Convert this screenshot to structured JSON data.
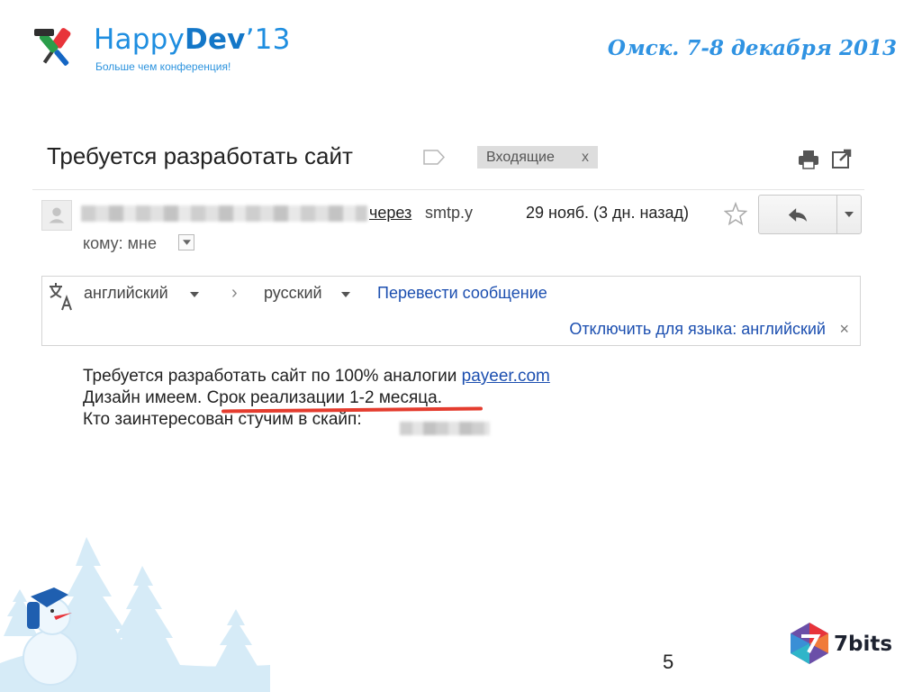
{
  "header": {
    "logo_happy": "Happy",
    "logo_dev": "Dev",
    "logo_year": "’13",
    "tagline": "Больше чем конференция!",
    "event_date": "Омск. 7-8 декабря 2013"
  },
  "email": {
    "subject": "Требуется разработать сайт",
    "label": "Входящие",
    "label_remove": "x",
    "via_label": "через",
    "via_host": "smtp.y",
    "date": "29 нояб. (3 дн. назад)",
    "to": "кому: мне",
    "translate": {
      "from_lang": "английский",
      "separator": "›",
      "to_lang": "русский",
      "translate_link": "Перевести сообщение",
      "disable_link": "Отключить для языка: английский",
      "close": "×"
    },
    "body": {
      "line1": "Требуется разработать сайт по 100%  аналогии ",
      "line1_link": "payeer.com",
      "line2_a": "Дизайн имеем. ",
      "line2_b": "Срок реализации 1-2 месяца.",
      "line3": "Кто заинтересован стучим в скайп: "
    }
  },
  "footer": {
    "page_number": "5",
    "brand": "7bits"
  },
  "colors": {
    "brand_blue": "#1f8ee0",
    "link_blue": "#1c4fb0",
    "highlight_red": "#e43c2e"
  },
  "icons": [
    "screwdriver-logo-icon",
    "label-tag-icon",
    "print-icon",
    "new-window-icon",
    "avatar-icon",
    "star-icon",
    "reply-icon",
    "dropdown-caret-icon",
    "translate-icon",
    "snowman-icon",
    "7bits-logo-icon"
  ]
}
